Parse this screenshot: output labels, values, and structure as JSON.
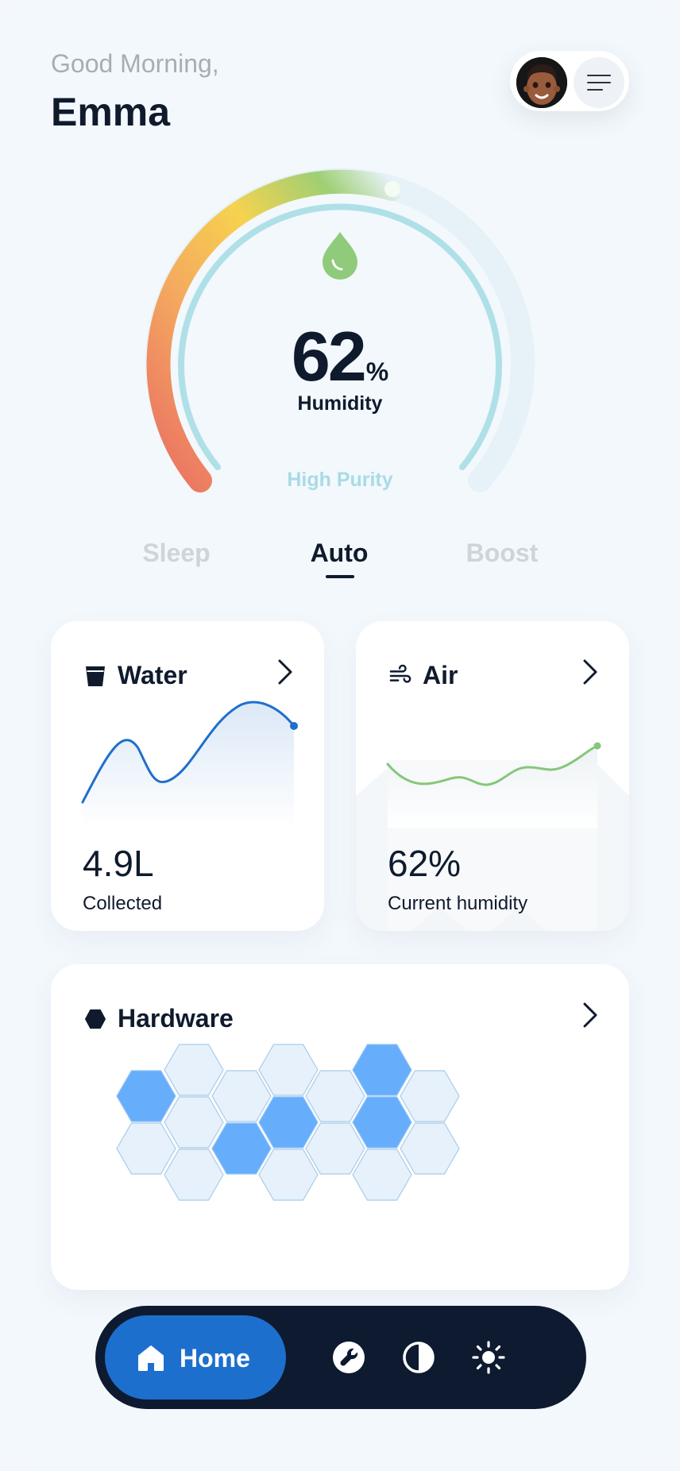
{
  "header": {
    "greeting": "Good Morning,",
    "user_name": "Emma",
    "avatar_icon": "memoji-avatar",
    "menu_icon": "hamburger-menu-icon"
  },
  "gauge": {
    "value": "62",
    "unit": "%",
    "label": "Humidity",
    "status": "High Purity",
    "level": 0.62,
    "icon": "water-drop-icon",
    "colors": {
      "low": "#ea6f63",
      "mid": "#f6d24f",
      "high": "#8fcb7a",
      "track": "#e6f2f7",
      "inner": "#afe0e8"
    }
  },
  "modes": {
    "items": [
      {
        "label": "Sleep",
        "active": false
      },
      {
        "label": "Auto",
        "active": true
      },
      {
        "label": "Boost",
        "active": false
      }
    ]
  },
  "water_card": {
    "title": "Water",
    "icon": "water-glass-icon",
    "value": "4.9L",
    "label": "Collected",
    "line_color": "#1f6fcb"
  },
  "air_card": {
    "title": "Air",
    "icon": "wind-icon",
    "value": "62%",
    "label": "Current humidity",
    "line_color": "#86c77a"
  },
  "hardware_card": {
    "title": "Hardware",
    "icon": "hexagon-icon",
    "active_color": "#66aefc",
    "inactive_color": "#e6f1fb"
  },
  "nav": {
    "home_label": "Home",
    "items": [
      "home-icon",
      "wrench-icon",
      "contrast-icon",
      "brightness-icon"
    ]
  }
}
